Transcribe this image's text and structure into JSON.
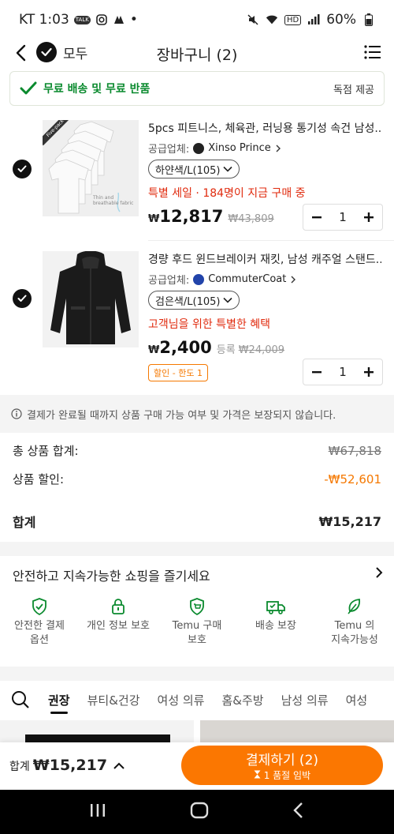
{
  "status": {
    "carrier_time": "KT 1:03",
    "dot": "•",
    "battery": "60%",
    "talk": "TALK",
    "hd": "HD"
  },
  "header": {
    "select_all": "모두",
    "title": "장바구니 (2)"
  },
  "promo": {
    "text": "무료 배송 및 무료 반품",
    "exclusive": "독점 제공"
  },
  "items": [
    {
      "title": "5pcs 피트니스, 체육관, 러닝용 통기성 속건 남성...",
      "seller_label": "공급업체:",
      "seller_name": "Xinso Prince",
      "variant": "하얀색/L(105)",
      "sale_text": "특별 세일 · 184명이 지금 구매 중",
      "currency": "₩",
      "price": "12,817",
      "orig_price": "₩43,809",
      "qty": "1",
      "img_label": "Five-pack",
      "img_text": "Thin and breathable fabric"
    },
    {
      "title": "경량 후드 윈드브레이커 재킷, 남성 캐주얼 스탠드...",
      "seller_label": "공급업체:",
      "seller_name": "CommuterCoat",
      "variant": "검은색/L(105)",
      "sale_text": "고객님을 위한 특별한 혜택",
      "currency": "₩",
      "price": "2,400",
      "reg_label": "등록",
      "orig_price": "₩24,009",
      "limit_badge": "할인 - 한도 1",
      "qty": "1"
    }
  ],
  "notice": "결제가 완료될 때까지 상품 구매 가능 여부 및 가격은 보장되지 않습니다.",
  "summary": {
    "subtotal_label": "총 상품 합계:",
    "subtotal": "₩67,818",
    "discount_label": "상품 할인:",
    "discount": "-₩52,601",
    "total_label": "합계",
    "total": "₩15,217"
  },
  "safe": {
    "title": "안전하고 지속가능한 쇼핑을 즐기세요",
    "items": [
      {
        "label": "안전한 결제\n옵션",
        "icon": "shield-check-icon"
      },
      {
        "label": "개인 정보 보호",
        "icon": "lock-icon"
      },
      {
        "label": "Temu 구매\n보호",
        "icon": "cart-shield-icon"
      },
      {
        "label": "배송 보장",
        "icon": "truck-check-icon"
      },
      {
        "label": "Temu 의\n지속가능성",
        "icon": "leaf-icon"
      }
    ]
  },
  "categories": [
    "권장",
    "뷰티&건강",
    "여성 의류",
    "홈&주방",
    "남성 의류",
    "여성"
  ],
  "checkout": {
    "total_label": "합계",
    "total": "₩15,217",
    "button": "결제하기 (2)",
    "sub": "1 품절 임박"
  },
  "colors": {
    "accent": "#fb7701",
    "green": "#0a8a2e",
    "sale_red": "#e02a0d"
  }
}
